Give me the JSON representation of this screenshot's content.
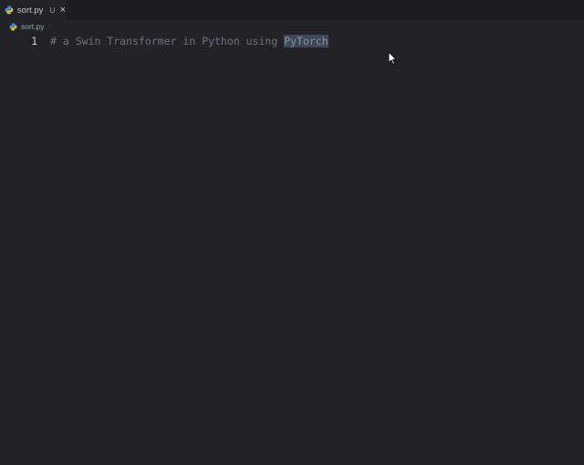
{
  "tabs": [
    {
      "label": "sort.py",
      "badge": "U",
      "close": "×",
      "icon": "python-icon"
    }
  ],
  "breadcrumb": {
    "file": "sort.py",
    "icon": "python-icon"
  },
  "editor": {
    "lines": [
      {
        "number": "1",
        "text_plain": "# a Swin Transformer in Python using ",
        "text_selected": "PyTorch"
      }
    ]
  },
  "colors": {
    "background": "#212328",
    "tabbar": "#1b1d21",
    "comment": "#6c7480",
    "selection": "#3e4756"
  }
}
